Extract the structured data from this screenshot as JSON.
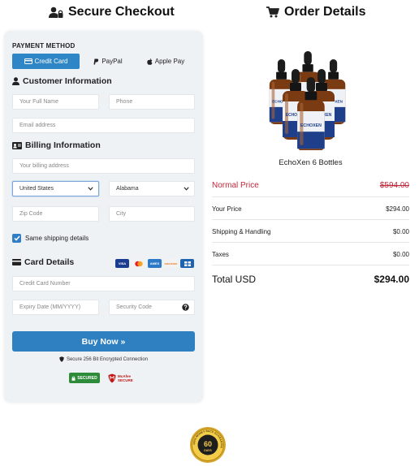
{
  "headers": {
    "checkout": "Secure Checkout",
    "order": "Order Details"
  },
  "payment": {
    "label": "PAYMENT METHOD",
    "tabs": [
      "Credit Card",
      "PayPal",
      "Apple Pay"
    ]
  },
  "customer": {
    "title": "Customer Information",
    "full_name_placeholder": "Your Full Name",
    "phone_placeholder": "Phone",
    "email_placeholder": "Email address"
  },
  "billing": {
    "title": "Billing Information",
    "address_placeholder": "Your billing address",
    "country": "United States",
    "state": "Alabama",
    "zip_placeholder": "Zip Code",
    "city_placeholder": "City",
    "same_shipping": "Same shipping details"
  },
  "card": {
    "title": "Card Details",
    "brands": [
      "VISA",
      "MC",
      "AMEX",
      "DISCOVER",
      "DINERS"
    ],
    "number_placeholder": "Credit Card Number",
    "expiry_placeholder": "Expiry Date (MM/YYYY)",
    "cvc_placeholder": "Security Code"
  },
  "buy_button": "Buy Now »",
  "secure_note": "Secure 256 Bit Encrypted Connection",
  "badges": {
    "sectigo": "SECURED",
    "mcafee_top": "McAfee",
    "mcafee_bottom": "SECURE"
  },
  "order": {
    "product_name": "EchoXen 6 Bottles",
    "bottle_label": "ECHOXEN",
    "normal_price_label": "Normal Price",
    "normal_price": "$594.00",
    "your_price_label": "Your Price",
    "your_price": "$294.00",
    "shipping_label": "Shipping & Handling",
    "shipping": "$0.00",
    "taxes_label": "Taxes",
    "taxes": "$0.00",
    "total_label": "Total USD",
    "total": "$294.00"
  },
  "guarantee": {
    "days": "60",
    "unit": "DAYS",
    "ring_text": "100% MONEY BACK GUARANTEE"
  },
  "colors": {
    "accent": "#2f86c6",
    "buy": "#2e80c0",
    "normal_price": "#c0283a",
    "panel": "#eef2f5"
  }
}
